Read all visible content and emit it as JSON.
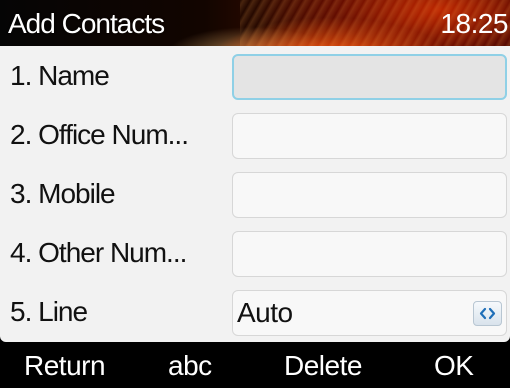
{
  "header": {
    "title": "Add Contacts",
    "clock": "18:25"
  },
  "form": {
    "rows": [
      {
        "label": "1.  Name",
        "value": ""
      },
      {
        "label": "2.  Office Num...",
        "value": ""
      },
      {
        "label": "3.  Mobile",
        "value": ""
      },
      {
        "label": "4.  Other Num...",
        "value": ""
      },
      {
        "label": "5.  Line",
        "value": "Auto",
        "control_icon": "left-right-arrows-icon"
      }
    ]
  },
  "softkeys": {
    "return_label": "Return",
    "input_mode_label": "abc",
    "delete_label": "Delete",
    "ok_label": "OK"
  },
  "colors": {
    "active_field_border": "#8fd0e6",
    "panel_background": "#f2f2f2",
    "softkey_bar": "#000000"
  }
}
